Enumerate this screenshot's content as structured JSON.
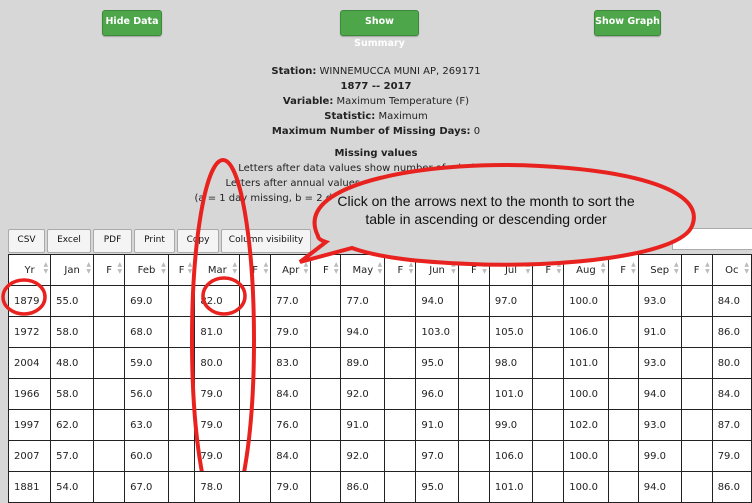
{
  "buttons": {
    "hide_data": "Hide Data",
    "show_summary": "Show Summary",
    "show_graph": "Show Graph"
  },
  "info": {
    "station_label": "Station:",
    "station_value": "WINNEMUCCA MUNI AP, 269171",
    "period": "1877 -- 2017",
    "variable_label": "Variable:",
    "variable_value": "Maximum Temperature  (F)",
    "statistic_label": "Statistic:",
    "statistic_value": "Maximum",
    "missing_days_label": "Maximum Number of Missing Days:",
    "missing_days_value": "0",
    "missing_values_heading": "Missing values",
    "missing_line1": "Letters after data values show number of missing days",
    "missing_line2": "Letters after annual values show number of missing months",
    "missing_line3": "(a = 1 day missing, b = 2 days missing, ... z = 26 or more days missing)"
  },
  "export_buttons": [
    "CSV",
    "Excel",
    "PDF",
    "Print",
    "Copy",
    "Column visibility"
  ],
  "callout": {
    "text": "Click on the arrows next to the month to sort the table in ascending or descending order",
    "color": "#e8231f"
  },
  "table": {
    "headers": [
      "Yr",
      "Jan",
      "F",
      "Feb",
      "F",
      "Mar",
      "F",
      "Apr",
      "F",
      "May",
      "F",
      "Jun",
      "F",
      "Jul",
      "F",
      "Aug",
      "F",
      "Sep",
      "F",
      "Oc"
    ],
    "rows": [
      [
        "1879",
        "55.0",
        "",
        "69.0",
        "",
        "82.0",
        "",
        "77.0",
        "",
        "77.0",
        "",
        "94.0",
        "",
        "97.0",
        "",
        "100.0",
        "",
        "93.0",
        "",
        "84.0"
      ],
      [
        "1972",
        "58.0",
        "",
        "68.0",
        "",
        "81.0",
        "",
        "79.0",
        "",
        "94.0",
        "",
        "103.0",
        "",
        "105.0",
        "",
        "106.0",
        "",
        "91.0",
        "",
        "86.0"
      ],
      [
        "2004",
        "48.0",
        "",
        "59.0",
        "",
        "80.0",
        "",
        "83.0",
        "",
        "89.0",
        "",
        "95.0",
        "",
        "98.0",
        "",
        "101.0",
        "",
        "93.0",
        "",
        "80.0"
      ],
      [
        "1966",
        "58.0",
        "",
        "56.0",
        "",
        "79.0",
        "",
        "84.0",
        "",
        "92.0",
        "",
        "96.0",
        "",
        "101.0",
        "",
        "100.0",
        "",
        "94.0",
        "",
        "84.0"
      ],
      [
        "1997",
        "62.0",
        "",
        "63.0",
        "",
        "79.0",
        "",
        "76.0",
        "",
        "91.0",
        "",
        "91.0",
        "",
        "99.0",
        "",
        "102.0",
        "",
        "93.0",
        "",
        "87.0"
      ],
      [
        "2007",
        "57.0",
        "",
        "60.0",
        "",
        "79.0",
        "",
        "84.0",
        "",
        "92.0",
        "",
        "97.0",
        "",
        "106.0",
        "",
        "100.0",
        "",
        "99.0",
        "",
        "79.0"
      ],
      [
        "1881",
        "54.0",
        "",
        "67.0",
        "",
        "78.0",
        "",
        "79.0",
        "",
        "86.0",
        "",
        "95.0",
        "",
        "101.0",
        "",
        "100.0",
        "",
        "94.0",
        "",
        "86.0"
      ]
    ]
  }
}
